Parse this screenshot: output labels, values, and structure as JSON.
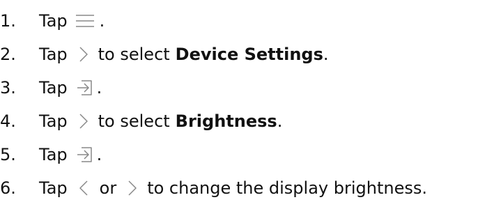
{
  "steps": [
    {
      "number": "1.",
      "verb": "Tap",
      "icon": "menu-lines-icon",
      "suffix": "."
    },
    {
      "number": "2.",
      "verb": "Tap",
      "icon": "chevron-right-icon",
      "text": "to select",
      "bold": "Device Settings",
      "suffix": "."
    },
    {
      "number": "3.",
      "verb": "Tap",
      "icon": "enter-arrow-icon",
      "suffix": "."
    },
    {
      "number": "4.",
      "verb": "Tap",
      "icon": "chevron-right-icon",
      "text": "to select",
      "bold": "Brightness",
      "suffix": "."
    },
    {
      "number": "5.",
      "verb": "Tap",
      "icon": "enter-arrow-icon",
      "suffix": "."
    },
    {
      "number": "6.",
      "verb": "Tap",
      "icon": "chevron-left-icon",
      "or": "or",
      "icon2": "chevron-right-icon",
      "text": "to change the display brightness."
    }
  ]
}
